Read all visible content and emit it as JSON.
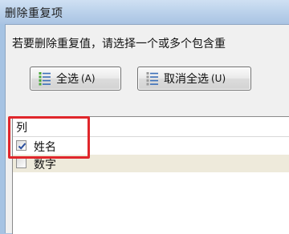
{
  "window": {
    "title": "删除重复项"
  },
  "dialog": {
    "instruction": "若要删除重复值，请选择一个或多个包含重",
    "buttons": {
      "select_all": {
        "label": "全选",
        "hotkey": "(A)"
      },
      "unselect_all": {
        "label": "取消全选",
        "hotkey": "(U)"
      }
    },
    "columns": {
      "header": "列",
      "items": [
        {
          "label": "姓名",
          "checked": true
        },
        {
          "label": "数字",
          "checked": false
        }
      ]
    }
  },
  "colors": {
    "highlight": "#e0262b",
    "checkmark": "#2a4f9e",
    "alt_row": "#eeeadb"
  }
}
